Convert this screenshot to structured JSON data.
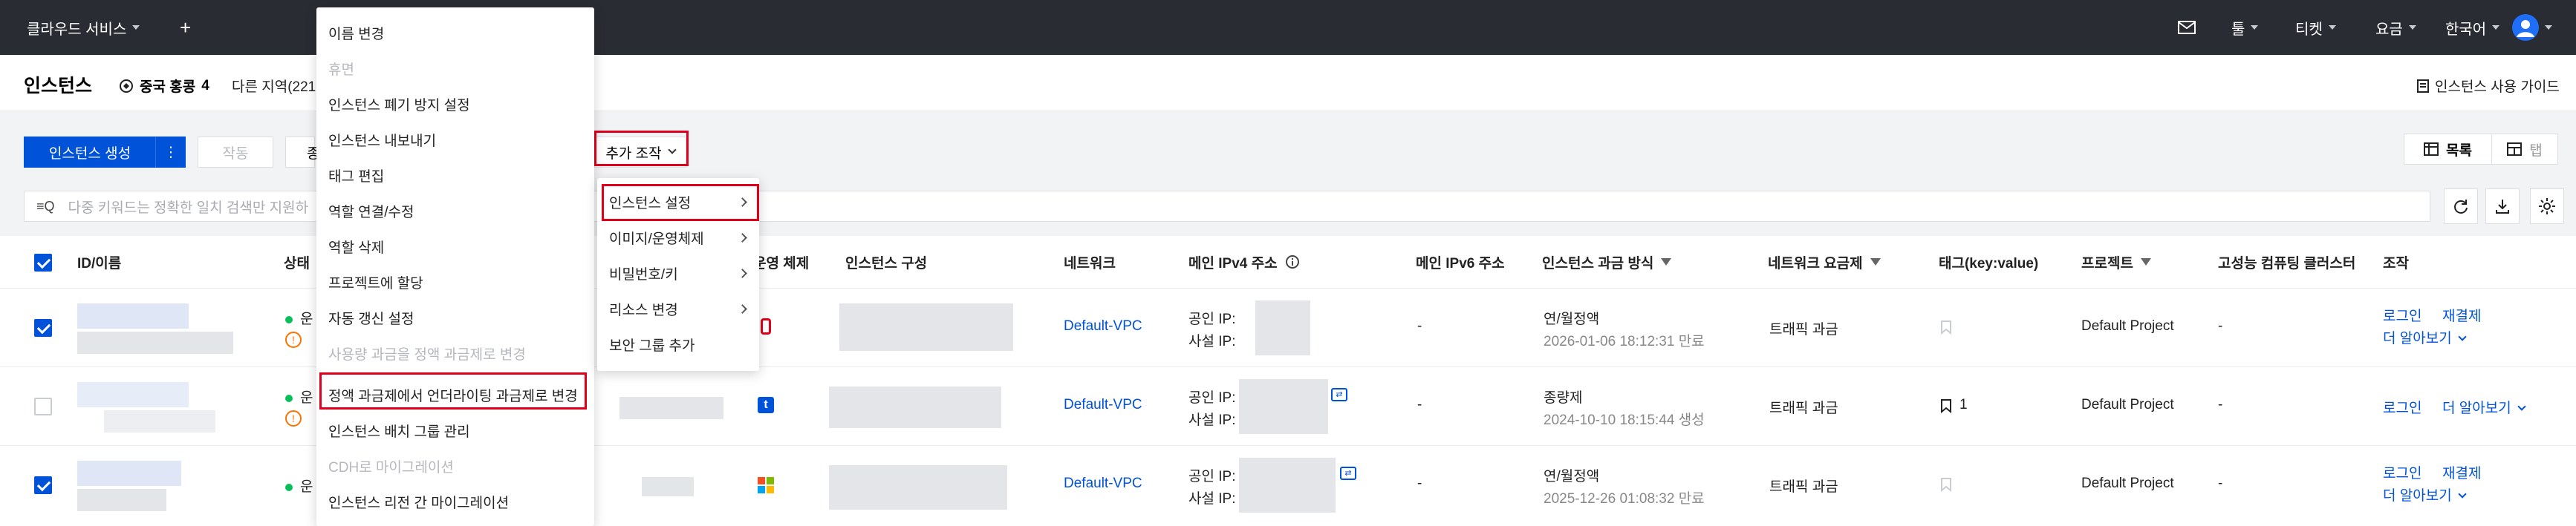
{
  "topbar": {
    "cloud_services": "클라우드 서비스",
    "plus": "+",
    "tools": "툴",
    "tickets": "티켓",
    "billing": "요금",
    "language": "한국어"
  },
  "page": {
    "title": "인스턴스",
    "region": "중국 홍콩",
    "region_count": "4",
    "other_regions": "다른 지역(221",
    "guide": "인스턴스 사용 가이드"
  },
  "toolbar": {
    "create": "인스턴스 생성",
    "more_dots": "⋮",
    "operate": "작동",
    "stop_partial": "종",
    "more_actions": "추가 조작",
    "view_list": "목록",
    "view_grid": "탭"
  },
  "search": {
    "prefix": "≡Q",
    "placeholder": "다중 키워드는 정확한 일치 검색만 지원하"
  },
  "table": {
    "headers": {
      "id_name": "ID/이름",
      "status": "상태",
      "os": "운영 체제",
      "config": "인스턴스 구성",
      "network": "네트워크",
      "ipv4": "메인 IPv4 주소",
      "ipv6": "메인 IPv6 주소",
      "billing_mode": "인스턴스 과금 방식",
      "network_billing": "네트워크 요금제",
      "tags": "태그(key:value)",
      "project": "프로젝트",
      "hpc": "고성능 컴퓨팅 클러스터",
      "action": "조작"
    },
    "rows": [
      {
        "status": "운",
        "network": "Default-VPC",
        "public_ip_label": "공인 IP:",
        "private_ip_label": "사설 IP:",
        "ipv6": "-",
        "billing_mode": "연/월정액",
        "billing_date": "2026-01-06 18:12:31 만료",
        "network_billing": "트래픽 과금",
        "tag_count": "",
        "project": "Default Project",
        "hpc": "-",
        "action_login": "로그인",
        "action_renew": "재결제",
        "action_more": "더 알아보기"
      },
      {
        "status": "운",
        "network": "Default-VPC",
        "public_ip_label": "공인 IP:",
        "private_ip_label": "사설 IP:",
        "ipv6": "-",
        "billing_mode": "종량제",
        "billing_date": "2024-10-10 18:15:44 생성",
        "network_billing": "트래픽 과금",
        "tag_count": "1",
        "project": "Default Project",
        "hpc": "-",
        "action_login": "로그인",
        "action_renew": "",
        "action_more": "더 알아보기"
      },
      {
        "status": "운",
        "network": "Default-VPC",
        "public_ip_label": "공인 IP:",
        "private_ip_label": "사설 IP:",
        "ipv6": "-",
        "billing_mode": "연/월정액",
        "billing_date": "2025-12-26 01:08:32 만료",
        "network_billing": "트래픽 과금",
        "tag_count": "",
        "project": "Default Project",
        "hpc": "-",
        "action_login": "로그인",
        "action_renew": "재결제",
        "action_more": "더 알아보기"
      }
    ]
  },
  "left_menu": {
    "items": [
      "이름 변경",
      "휴면",
      "인스턴스 폐기 방지 설정",
      "인스턴스 내보내기",
      "태그 편집",
      "역할 연결/수정",
      "역할 삭제",
      "프로젝트에 할당",
      "자동 갱신 설정",
      "사용량 과금을 정액 과금제로 변경",
      "정액 과금제에서 언더라이팅 과금제로 변경",
      "인스턴스 배치 그룹 관리",
      "CDH로 마이그레이션",
      "인스턴스 리전 간 마이그레이션"
    ]
  },
  "submenu": {
    "items": [
      "인스턴스 설정",
      "이미지/운영체제",
      "비밀번호/키",
      "리소스 변경",
      "보안 그룹 추가"
    ]
  }
}
